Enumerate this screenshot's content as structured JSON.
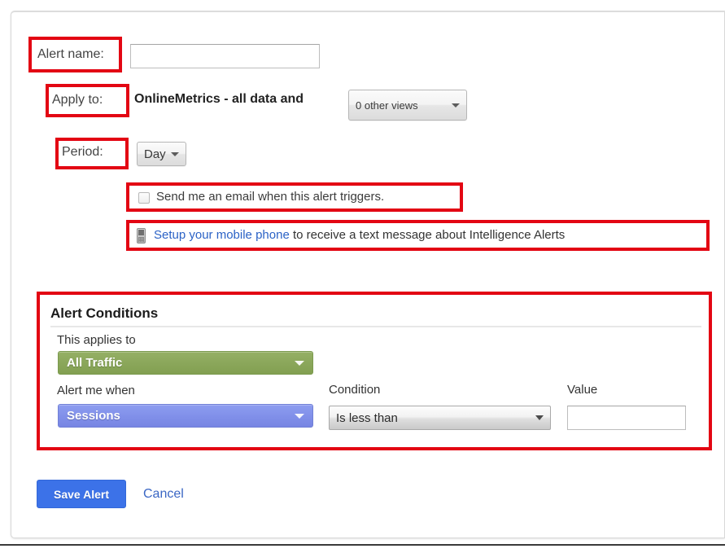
{
  "form": {
    "alert_name": {
      "label": "Alert name:",
      "value": "",
      "placeholder": ""
    },
    "apply_to": {
      "label": "Apply to:",
      "profile_text": "OnlineMetrics - all data and",
      "views_select": "0 other views"
    },
    "period": {
      "label": "Period:",
      "value": "Day"
    },
    "email_checkbox": {
      "label": "Send me an email when this alert triggers.",
      "checked": false
    },
    "mobile": {
      "icon": "mobile-phone-icon",
      "link_text": "Setup your mobile phone",
      "rest_text": " to receive a text message about Intelligence Alerts"
    }
  },
  "alert_conditions": {
    "title": "Alert Conditions",
    "applies_to_label": "This applies to",
    "applies_to_value": "All Traffic",
    "alert_me_when_label": "Alert me when",
    "alert_me_when_value": "Sessions",
    "condition_label": "Condition",
    "condition_value": "Is less than",
    "value_label": "Value",
    "value_field": "",
    "colors": {
      "applies_to_green": "#8aa65a",
      "metric_blue": "#808fe9"
    }
  },
  "footer": {
    "save_label": "Save Alert",
    "cancel_label": "Cancel",
    "save_color": "#3c72e8",
    "cancel_color": "#3a66c4"
  },
  "annotations": {
    "highlight_color": "#e30613",
    "boxes": [
      "alert-name-label",
      "apply-to-label",
      "period-label",
      "email-checkbox-row",
      "mobile-setup-row",
      "alert-conditions-panel"
    ]
  }
}
